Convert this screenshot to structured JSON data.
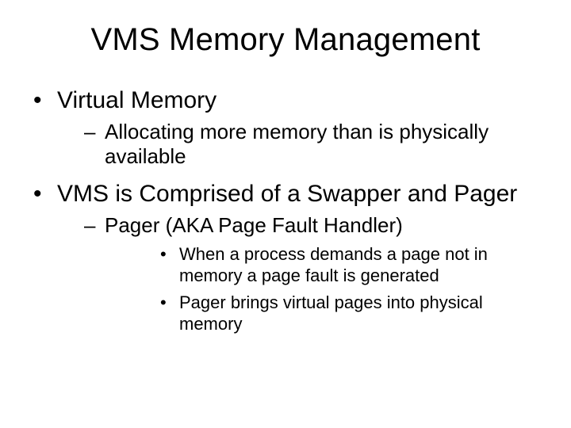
{
  "title": "VMS Memory Management",
  "bullets": [
    {
      "text": "Virtual Memory",
      "sub": [
        {
          "text": "Allocating more memory than is physically available",
          "sub": []
        }
      ]
    },
    {
      "text": "VMS is Comprised of a Swapper and Pager",
      "sub": [
        {
          "text": "Pager (AKA Page Fault Handler)",
          "sub": [
            {
              "text": "When a process demands a page not in memory a page fault is generated"
            },
            {
              "text": "Pager brings virtual pages into physical memory"
            }
          ]
        }
      ]
    }
  ]
}
